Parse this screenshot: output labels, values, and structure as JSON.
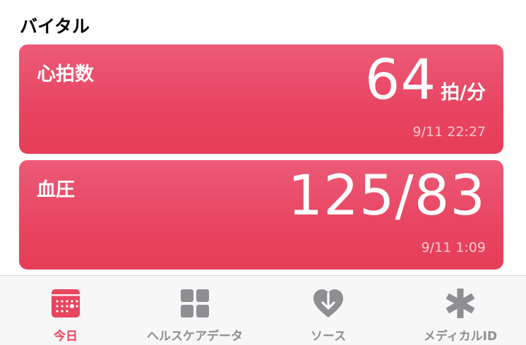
{
  "section": {
    "title": "バイタル"
  },
  "cards": {
    "heart_rate": {
      "title": "心拍数",
      "value": "64",
      "unit": "拍/分",
      "time": "9/11 22:27"
    },
    "blood_pressure": {
      "title": "血圧",
      "value": "125/83",
      "time": "9/11 1:09"
    }
  },
  "tabs": [
    {
      "label": "今日",
      "icon": "calendar-icon",
      "active": true
    },
    {
      "label": "ヘルスケアデータ",
      "icon": "grid-icon",
      "active": false
    },
    {
      "label": "ソース",
      "icon": "heart-arrow-icon",
      "active": false
    },
    {
      "label": "メディカルID",
      "icon": "asterisk-icon",
      "active": false
    }
  ],
  "colors": {
    "accent": "#e8455f",
    "card_gradient_top": "#ec5a77",
    "card_gradient_bottom": "#e63d58",
    "tab_inactive": "#8e8e93",
    "tabbar_background": "#f7f7f7"
  }
}
